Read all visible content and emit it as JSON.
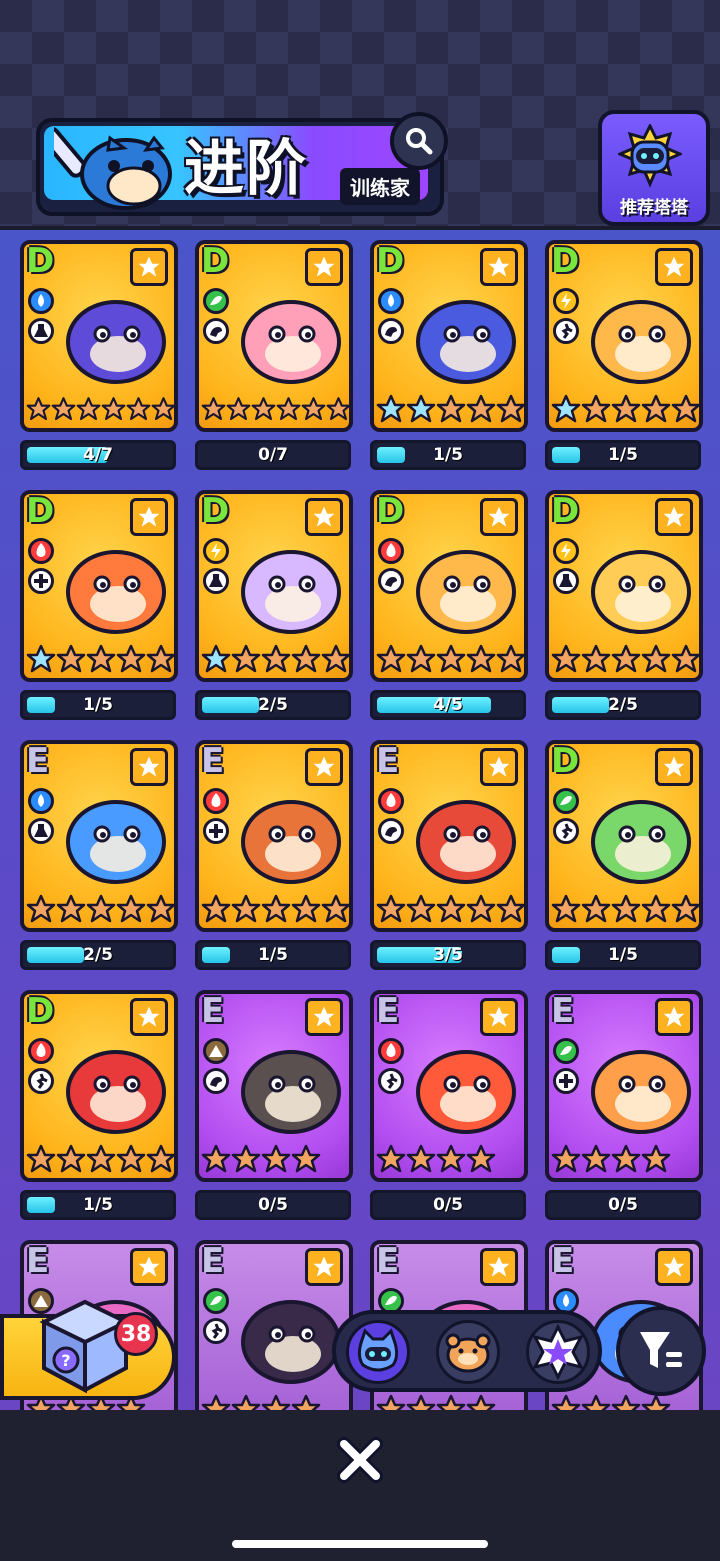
{
  "header": {
    "title": "进阶",
    "subtitle": "训练家",
    "recommend_label": "推荐塔塔"
  },
  "colors": {
    "tier_D": "#7ae53b",
    "tier_E": "#c8c4e8",
    "water": "#2b8cff",
    "grass": "#36c24a",
    "electric": "#ffc21a",
    "fire": "#ff3b3b",
    "rock": "#8b6b3d",
    "progress_fill": "#26c4e8"
  },
  "cards": [
    {
      "tier": "D",
      "element": "water",
      "role": "support-flask",
      "bg": "gold",
      "stars_blue": 0,
      "stars_gold": 6,
      "stars_total": 6,
      "progress": "4/7",
      "ratio": 0.57,
      "creature": "butterfly"
    },
    {
      "tier": "D",
      "element": "grass",
      "role": "bird",
      "bg": "gold",
      "stars_blue": 0,
      "stars_gold": 6,
      "stars_total": 6,
      "progress": "0/7",
      "ratio": 0,
      "creature": "mantis"
    },
    {
      "tier": "D",
      "element": "water",
      "role": "bird",
      "bg": "gold",
      "stars_blue": 2,
      "stars_gold": 3,
      "stars_total": 5,
      "progress": "1/5",
      "ratio": 0.2,
      "creature": "frog"
    },
    {
      "tier": "D",
      "element": "electric",
      "role": "runner",
      "bg": "gold",
      "stars_blue": 1,
      "stars_gold": 4,
      "stars_total": 5,
      "progress": "1/5",
      "ratio": 0.2,
      "creature": "dog"
    },
    {
      "tier": "D",
      "element": "fire",
      "role": "plus",
      "bg": "gold",
      "stars_blue": 1,
      "stars_gold": 4,
      "stars_total": 5,
      "progress": "1/5",
      "ratio": 0.2,
      "creature": "rabbit"
    },
    {
      "tier": "D",
      "element": "electric",
      "role": "support-flask",
      "bg": "gold",
      "stars_blue": 1,
      "stars_gold": 4,
      "stars_total": 5,
      "progress": "2/5",
      "ratio": 0.4,
      "creature": "sheep"
    },
    {
      "tier": "D",
      "element": "fire",
      "role": "bird",
      "bg": "gold",
      "stars_blue": 0,
      "stars_gold": 5,
      "stars_total": 5,
      "progress": "4/5",
      "ratio": 0.8,
      "creature": "dog"
    },
    {
      "tier": "D",
      "element": "electric",
      "role": "support-flask",
      "bg": "gold",
      "stars_blue": 0,
      "stars_gold": 5,
      "stars_total": 5,
      "progress": "2/5",
      "ratio": 0.4,
      "creature": "lion"
    },
    {
      "tier": "E",
      "element": "water",
      "role": "support-flask",
      "bg": "gold",
      "stars_blue": 0,
      "stars_gold": 5,
      "stars_total": 5,
      "progress": "2/5",
      "ratio": 0.4,
      "creature": "ghost"
    },
    {
      "tier": "E",
      "element": "fire",
      "role": "plus",
      "bg": "gold",
      "stars_blue": 0,
      "stars_gold": 5,
      "stars_total": 5,
      "progress": "1/5",
      "ratio": 0.2,
      "creature": "burger"
    },
    {
      "tier": "E",
      "element": "fire",
      "role": "bird",
      "bg": "gold",
      "stars_blue": 0,
      "stars_gold": 5,
      "stars_total": 5,
      "progress": "3/5",
      "ratio": 0.6,
      "creature": "frog2"
    },
    {
      "tier": "D",
      "element": "grass",
      "role": "runner",
      "bg": "gold",
      "stars_blue": 0,
      "stars_gold": 5,
      "stars_total": 5,
      "progress": "1/5",
      "ratio": 0.2,
      "creature": "cat"
    },
    {
      "tier": "D",
      "element": "fire",
      "role": "runner",
      "bg": "gold",
      "stars_blue": 0,
      "stars_gold": 5,
      "stars_total": 5,
      "progress": "1/5",
      "ratio": 0.2,
      "creature": "lizard"
    },
    {
      "tier": "E",
      "element": "rock",
      "role": "bird",
      "bg": "purple",
      "stars_blue": 0,
      "stars_gold": 4,
      "stars_total": 4,
      "progress": "0/5",
      "ratio": 0,
      "creature": "seal"
    },
    {
      "tier": "E",
      "element": "fire",
      "role": "runner",
      "bg": "purple",
      "stars_blue": 0,
      "stars_gold": 4,
      "stars_total": 4,
      "progress": "0/5",
      "ratio": 0,
      "creature": "fox"
    },
    {
      "tier": "E",
      "element": "grass",
      "role": "plus",
      "bg": "purple",
      "stars_blue": 0,
      "stars_gold": 4,
      "stars_total": 4,
      "progress": "0/5",
      "ratio": 0,
      "creature": "flower"
    },
    {
      "tier": "E",
      "element": "rock",
      "role": "bird",
      "bg": "faded",
      "stars_blue": 0,
      "stars_gold": 4,
      "stars_total": 4,
      "progress": "",
      "ratio": 0,
      "creature": "blob"
    },
    {
      "tier": "E",
      "element": "grass",
      "role": "runner",
      "bg": "faded",
      "stars_blue": 0,
      "stars_gold": 4,
      "stars_total": 4,
      "progress": "",
      "ratio": 0,
      "creature": "bug"
    },
    {
      "tier": "E",
      "element": "grass",
      "role": "bird",
      "bg": "faded",
      "stars_blue": 0,
      "stars_gold": 4,
      "stars_total": 4,
      "progress": "",
      "ratio": 0,
      "creature": "blob"
    },
    {
      "tier": "E",
      "element": "water",
      "role": "runner",
      "bg": "faded",
      "stars_blue": 0,
      "stars_gold": 4,
      "stars_total": 4,
      "progress": "",
      "ratio": 0,
      "creature": "bird"
    }
  ],
  "gift": {
    "count": "38"
  },
  "filters": [
    {
      "icon": "cat-mascot-icon",
      "active": true
    },
    {
      "icon": "hamster-icon",
      "active": false
    },
    {
      "icon": "star-badge-icon",
      "active": false
    }
  ]
}
